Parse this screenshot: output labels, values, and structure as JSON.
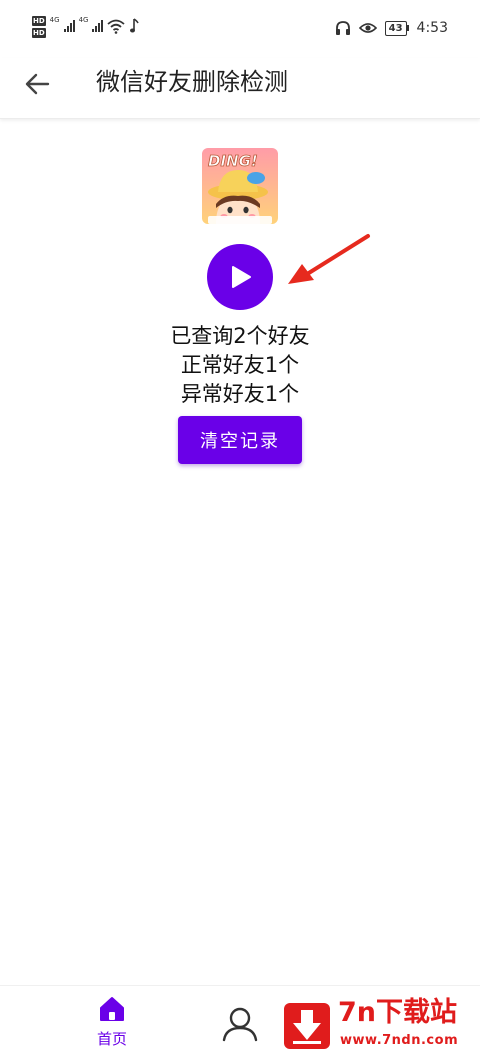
{
  "status_bar": {
    "hd_labels": [
      "HD",
      "HD"
    ],
    "network_labels": [
      "4G",
      "4G"
    ],
    "battery_level": "43",
    "time": "4:53"
  },
  "app_bar": {
    "title": "微信好友删除检测"
  },
  "content": {
    "avatar_text": "DING!",
    "stats": [
      "已查询2个好友",
      "正常好友1个",
      "异常好友1个"
    ],
    "clear_button_label": "清空记录"
  },
  "bottom_nav": {
    "home_label": "首页",
    "accent_color": "#6a00e8"
  },
  "watermark": {
    "title": "7n下载站",
    "url": "www.7ndn.com",
    "color": "#e01c1c"
  }
}
